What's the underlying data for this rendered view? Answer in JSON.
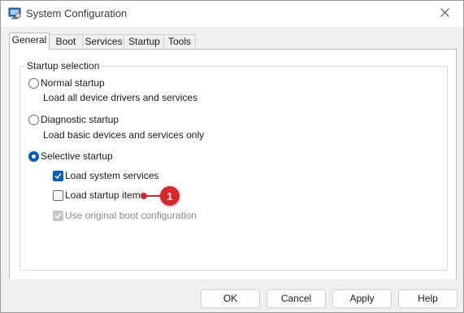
{
  "window": {
    "title": "System Configuration"
  },
  "tabs": [
    "General",
    "Boot",
    "Services",
    "Startup",
    "Tools"
  ],
  "group": {
    "legend": "Startup selection",
    "normal": {
      "label": "Normal startup",
      "desc": "Load all device drivers and services"
    },
    "diagnostic": {
      "label": "Diagnostic startup",
      "desc": "Load basic devices and services only"
    },
    "selective": {
      "label": "Selective startup"
    },
    "options": {
      "system_services": "Load system services",
      "startup_items": "Load startup items",
      "boot_config": "Use original boot configuration"
    }
  },
  "callout": {
    "number": "1"
  },
  "buttons": {
    "ok": "OK",
    "cancel": "Cancel",
    "apply": "Apply",
    "help": "Help"
  },
  "colors": {
    "accent": "#005fb8",
    "callout": "#d9262b"
  }
}
